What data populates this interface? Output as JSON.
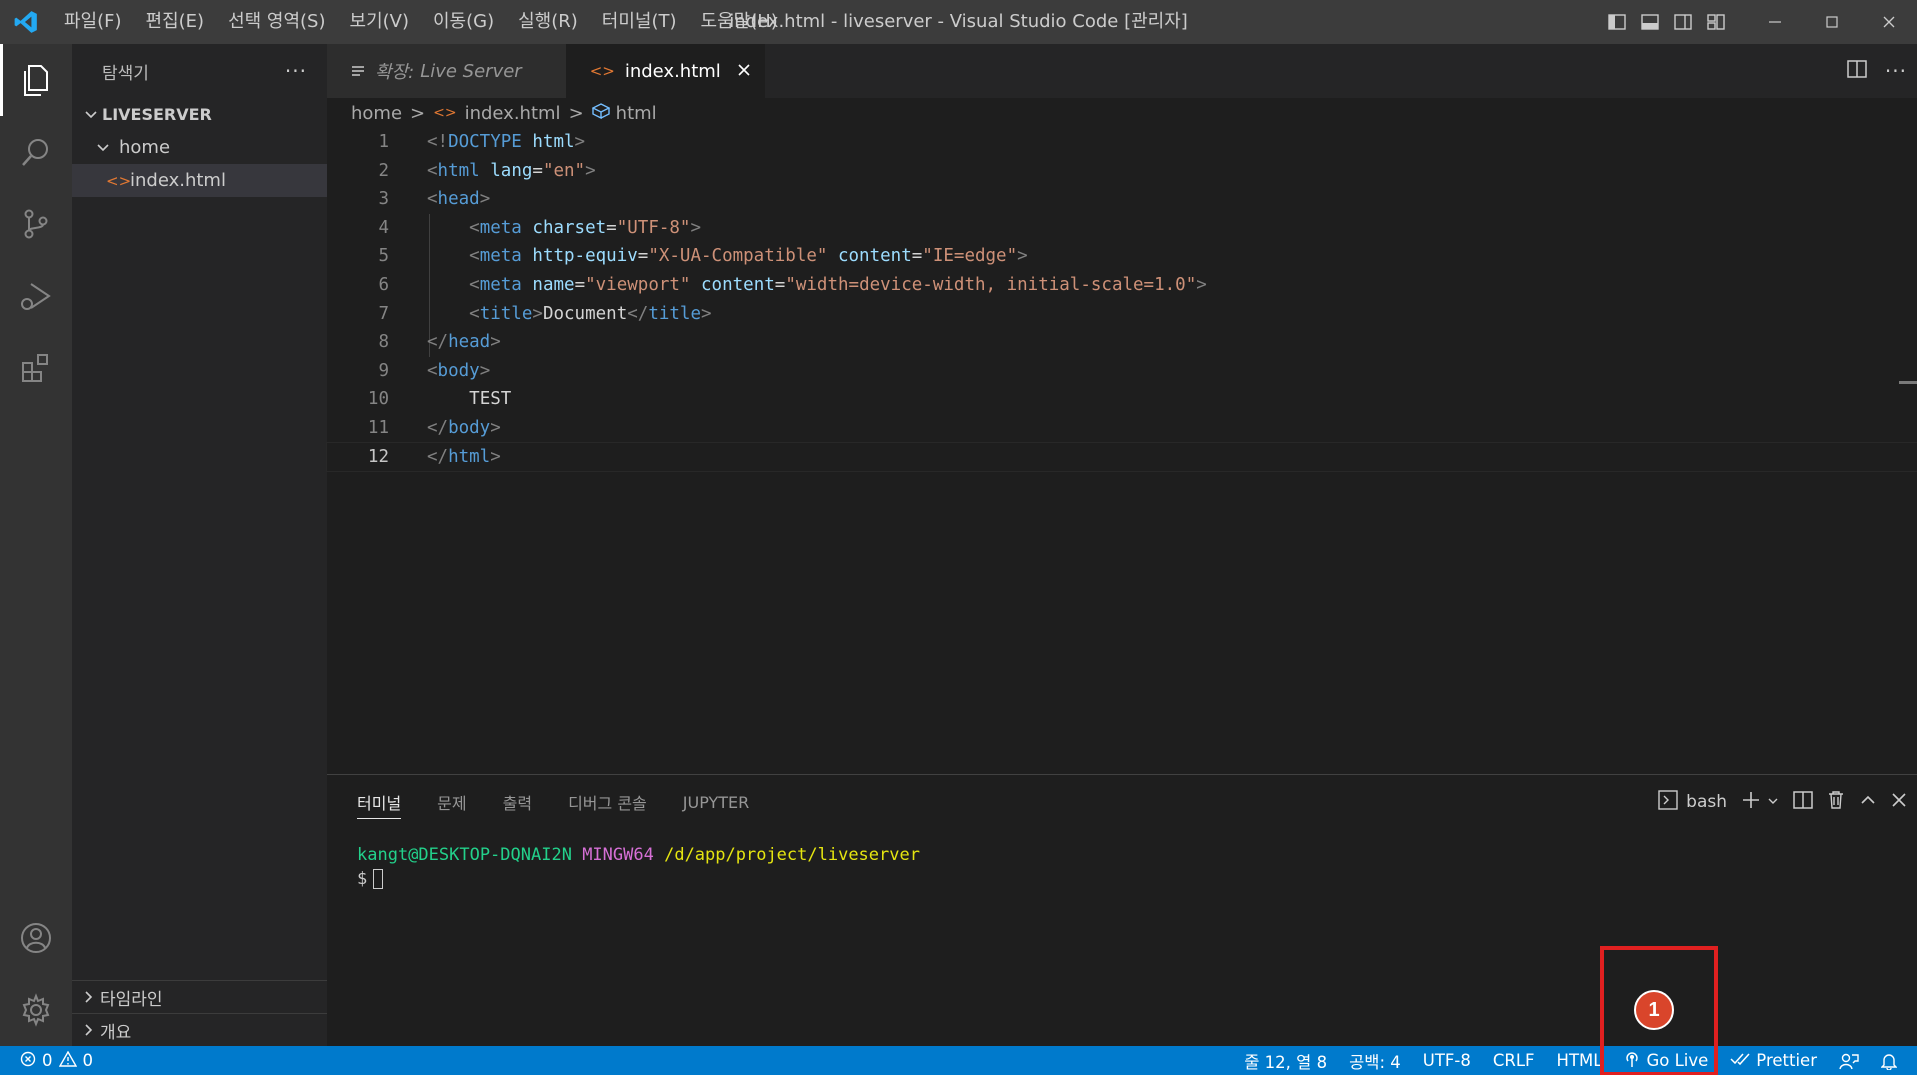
{
  "window": {
    "title": "index.html - liveserver - Visual Studio Code [관리자]",
    "menu": [
      "파일(F)",
      "편집(E)",
      "선택 영역(S)",
      "보기(V)",
      "이동(G)",
      "실행(R)",
      "터미널(T)",
      "도움말(H)"
    ]
  },
  "sidebar": {
    "title": "탐색기",
    "more": "···",
    "folder": "LIVESERVER",
    "subfolder": "home",
    "file": "index.html",
    "bottom_sections": [
      "타임라인",
      "개요"
    ]
  },
  "tabs": [
    {
      "prefix": "확장:",
      "label": "Live Server",
      "active": false
    },
    {
      "label": "index.html",
      "active": true
    }
  ],
  "breadcrumb": {
    "folder": "home",
    "file": "index.html",
    "symbol": "html"
  },
  "editor": {
    "current_line": 12,
    "line_numbers": [
      "1",
      "2",
      "3",
      "4",
      "5",
      "6",
      "7",
      "8",
      "9",
      "10",
      "11",
      "12"
    ],
    "code": {
      "l1_open": "<!",
      "l1_doctype": "DOCTYPE",
      "l1_html": "html",
      "l2_tag": "html",
      "l2_attr": "lang",
      "l2_val": "\"en\"",
      "l3_tag": "head",
      "l4_tag": "meta",
      "l4_attr": "charset",
      "l4_val": "\"UTF-8\"",
      "l5_tag": "meta",
      "l5_attr1": "http-equiv",
      "l5_val1": "\"X-UA-Compatible\"",
      "l5_attr2": "content",
      "l5_val2": "\"IE=edge\"",
      "l6_tag": "meta",
      "l6_attr1": "name",
      "l6_val1": "\"viewport\"",
      "l6_attr2": "content",
      "l6_val2": "\"width=device-width, initial-scale=1.0\"",
      "l7_tag": "title",
      "l7_text": "Document",
      "l8_tag": "head",
      "l9_tag": "body",
      "l10_text": "TEST",
      "l11_tag": "body",
      "l12_tag": "html"
    }
  },
  "panel": {
    "tabs": [
      "터미널",
      "문제",
      "출력",
      "디버그 콘솔",
      "JUPYTER"
    ],
    "shell": "bash",
    "terminal": {
      "user": "kangt@DESKTOP-DQNAI2N",
      "env": "MINGW64",
      "path": "/d/app/project/liveserver",
      "prompt": "$"
    }
  },
  "statusbar": {
    "errors": "0",
    "warnings": "0",
    "position": "줄 12, 열 8",
    "spaces": "공백: 4",
    "encoding": "UTF-8",
    "eol": "CRLF",
    "language": "HTML",
    "go_live": "Go Live",
    "prettier": "Prettier"
  },
  "annotation": {
    "badge": "1",
    "color": "#e02020"
  },
  "colors": {
    "accent": "#007acc",
    "titlebar": "#3c3c3c",
    "editor_bg": "#1e1e1e"
  }
}
